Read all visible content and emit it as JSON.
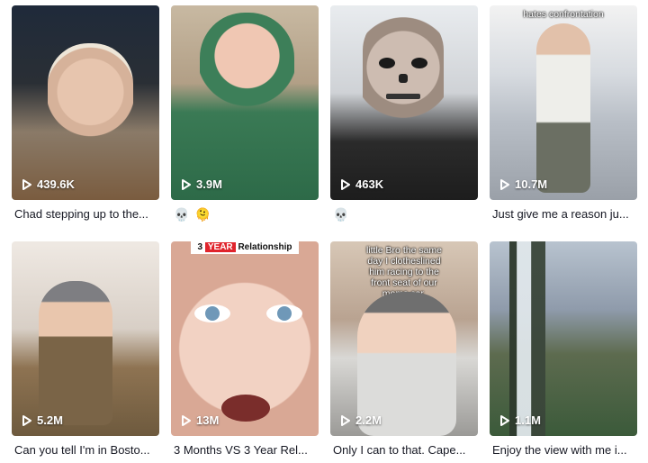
{
  "videos": [
    {
      "views": "439.6K",
      "caption": "Chad stepping up to the...",
      "overlay": "",
      "colors": [
        "#1f2a3a",
        "#c9a98c"
      ]
    },
    {
      "views": "3.9M",
      "caption": "",
      "emojis": [
        "💀",
        "🫠"
      ],
      "overlay": "",
      "colors": [
        "#b7a992",
        "#3a7a55"
      ]
    },
    {
      "views": "463K",
      "caption": "",
      "emojis": [
        "💀"
      ],
      "overlay": "",
      "colors": [
        "#4a4a4a",
        "#c8b6aa"
      ]
    },
    {
      "views": "10.7M",
      "caption": "Just give me a reason ju...",
      "overlay": "hates confrontation",
      "colors": [
        "#c6ccd3",
        "#6b7080"
      ]
    },
    {
      "views": "5.2M",
      "caption": "Can you tell I'm in Bosto...",
      "overlay": "",
      "colors": [
        "#d8cfc6",
        "#6e5a3e"
      ]
    },
    {
      "views": "13M",
      "caption": "3 Months VS 3 Year Rel...",
      "overlay": "",
      "banner": {
        "prefix": "3",
        "red": "YEAR",
        "rest": "Relationship"
      },
      "colors": [
        "#e8c7b6",
        "#d79f8c"
      ]
    },
    {
      "views": "2.2M",
      "caption": "Only I can to that. Cape...",
      "overlay": "little Bro the same day I clotheslined him racing to the front seat of our moms car.",
      "colors": [
        "#c9b7a4",
        "#5c4a45"
      ]
    },
    {
      "views": "1.1M",
      "caption": "Enjoy the view with me i...",
      "overlay": "",
      "colors": [
        "#9aa7b7",
        "#3f5a3a"
      ]
    }
  ]
}
